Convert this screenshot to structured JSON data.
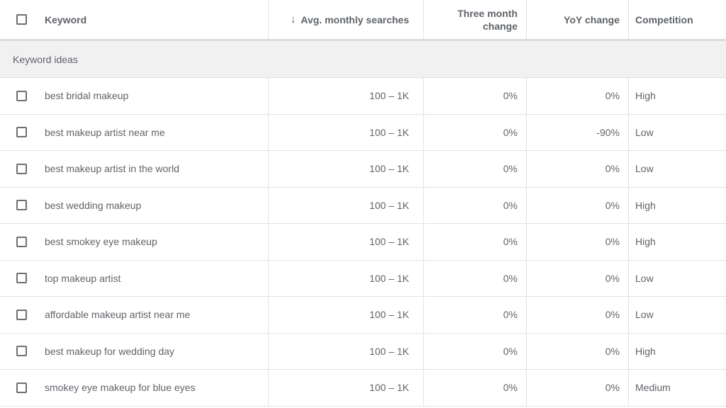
{
  "header": {
    "keyword": "Keyword",
    "avg_monthly_searches": "Avg. monthly searches",
    "sort_icon": "arrow-down-icon",
    "three_month_change_line1": "Three month",
    "three_month_change_line2": "change",
    "yoy_change": "YoY change",
    "competition": "Competition"
  },
  "section": {
    "title": "Keyword ideas"
  },
  "rows": [
    {
      "keyword": "best bridal makeup",
      "avg": "100 – 1K",
      "three_month": "0%",
      "yoy": "0%",
      "competition": "High"
    },
    {
      "keyword": "best makeup artist near me",
      "avg": "100 – 1K",
      "three_month": "0%",
      "yoy": "-90%",
      "competition": "Low"
    },
    {
      "keyword": "best makeup artist in the world",
      "avg": "100 – 1K",
      "three_month": "0%",
      "yoy": "0%",
      "competition": "Low"
    },
    {
      "keyword": "best wedding makeup",
      "avg": "100 – 1K",
      "three_month": "0%",
      "yoy": "0%",
      "competition": "High"
    },
    {
      "keyword": "best smokey eye makeup",
      "avg": "100 – 1K",
      "three_month": "0%",
      "yoy": "0%",
      "competition": "High"
    },
    {
      "keyword": "top makeup artist",
      "avg": "100 – 1K",
      "three_month": "0%",
      "yoy": "0%",
      "competition": "Low"
    },
    {
      "keyword": "affordable makeup artist near me",
      "avg": "100 – 1K",
      "three_month": "0%",
      "yoy": "0%",
      "competition": "Low"
    },
    {
      "keyword": "best makeup for wedding day",
      "avg": "100 – 1K",
      "three_month": "0%",
      "yoy": "0%",
      "competition": "High"
    },
    {
      "keyword": "smokey eye makeup for blue eyes",
      "avg": "100 – 1K",
      "three_month": "0%",
      "yoy": "0%",
      "competition": "Medium"
    }
  ]
}
